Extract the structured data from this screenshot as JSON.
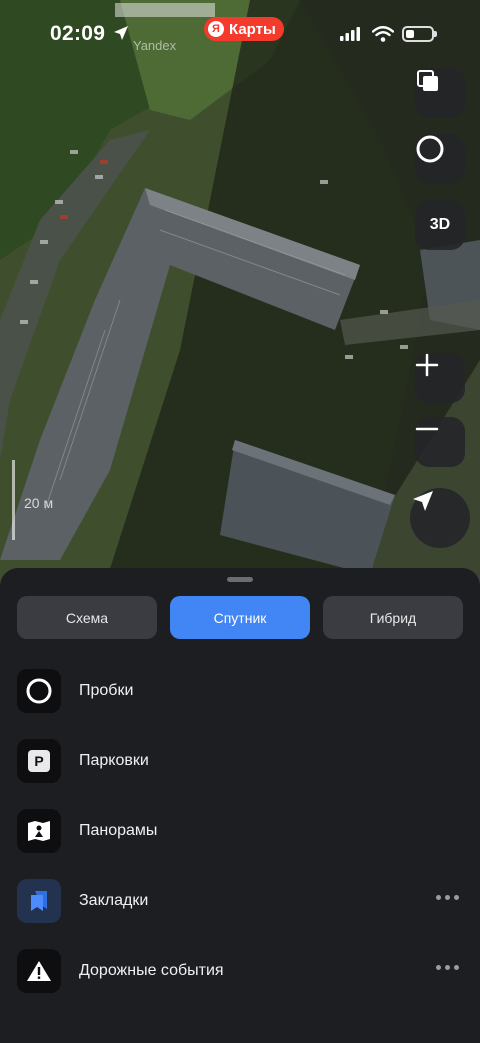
{
  "status_bar": {
    "time": "02:09",
    "app_badge_logo": "Я",
    "app_badge_text": "Карты",
    "battery_level": 0.35
  },
  "map": {
    "watermark": "Yandex",
    "scale_label": "20 м",
    "controls": {
      "three_d_label": "3D"
    }
  },
  "sheet": {
    "map_types": [
      {
        "label": "Схема",
        "active": false
      },
      {
        "label": "Спутник",
        "active": true
      },
      {
        "label": "Гибрид",
        "active": false
      }
    ],
    "layers": [
      {
        "label": "Пробки",
        "icon": "traffic-icon",
        "has_more": false
      },
      {
        "label": "Парковки",
        "icon": "parking-icon",
        "icon_text": "P",
        "has_more": false
      },
      {
        "label": "Панорамы",
        "icon": "panorama-icon",
        "has_more": false
      },
      {
        "label": "Закладки",
        "icon": "bookmarks-icon",
        "has_more": true
      },
      {
        "label": "Дорожные события",
        "icon": "road-events-icon",
        "has_more": true
      }
    ]
  },
  "colors": {
    "accent": "#4285f4",
    "badge_red": "#f33a2d",
    "sheet_bg": "#1d1e22",
    "segment_bg": "#3a3c42"
  }
}
